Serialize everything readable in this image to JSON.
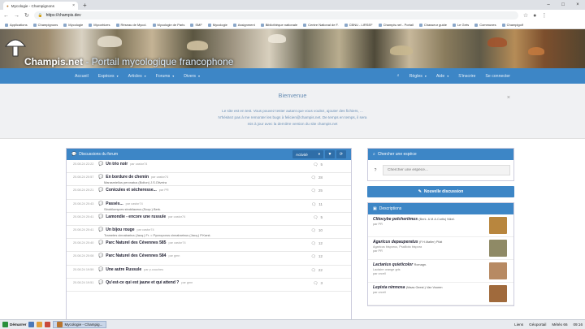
{
  "browser": {
    "tab_title": "Mycologie - Champignons",
    "new_tab": "+",
    "url": "https://champis.dev",
    "bookmarks": [
      "Applications",
      "Champignons",
      "Mycologie",
      "Mycorhizes",
      "Réseau de Mycol.",
      "Mycologie de Paris",
      "SMF",
      "Mycologie",
      "Assignment",
      "Bibliothèque nationale",
      "Centre National de F.",
      "CBNU - LIRSEF",
      "Champis.net - Portail",
      "Chasseur guide",
      "Le Grès",
      "Communes",
      "Champigolf"
    ]
  },
  "site": {
    "name": "Champis.net",
    "tagline": " - Portail mycologique francophone"
  },
  "nav": {
    "left": [
      {
        "label": "Accueil",
        "caret": false
      },
      {
        "label": "Espèces",
        "caret": true
      },
      {
        "label": "Articles",
        "caret": true
      },
      {
        "label": "Forums",
        "caret": true
      },
      {
        "label": "Divers",
        "caret": true
      }
    ],
    "right": [
      {
        "label": "Règles",
        "caret": true
      },
      {
        "label": "Aide",
        "caret": true
      },
      {
        "label": "S'inscrire",
        "caret": false
      },
      {
        "label": "Se connecter",
        "caret": false
      }
    ]
  },
  "welcome": {
    "title": "Bienvenue",
    "lines": [
      "Le site est en test. Vous pouvez tester autant que vous voulez, ajouter des fichiers, ...",
      "N'hésitez pas à me remonter les bugs à felicien@champis.net. De temps en temps, il sera",
      "mis à jour avec la dernière version du site champis.net"
    ],
    "close": "×"
  },
  "forum": {
    "title": "Discussions du forum",
    "filter_label": "Activité",
    "rows": [
      {
        "date": "20.08.24 22:22",
        "title": "Un trio noir",
        "by": "par castor74",
        "sub": "",
        "count": "5"
      },
      {
        "date": "20.08.24 20:57",
        "title": "En bordure de chemin",
        "by": "par castor74",
        "sub": "Marasmiellus peronatus (Bolton) J.S.Oliveira",
        "count": "28"
      },
      {
        "date": "20.08.24 20:21",
        "title": "Conicules et sécheresse...",
        "by": "par PR",
        "sub": "",
        "count": "25"
      },
      {
        "date": "20.08.24 20:43",
        "title": "Passés...",
        "by": "par castor74",
        "sub": "Strobilomyces strobilaceus (Scop.) Berk.",
        "count": "11"
      },
      {
        "date": "20.08.24 20:41",
        "title": "Lamondie - encore une russule",
        "by": "par castor74",
        "sub": "",
        "count": "5"
      },
      {
        "date": "20.08.24 20:41",
        "title": "Un bijou rouge",
        "by": "par castor74",
        "sub": "Trametes cinnabarina (Jacq.) Fr. = Pycnoporus cinnabarinus (Jacq.) P.Karst.",
        "count": "10"
      },
      {
        "date": "20.08.24 20:40",
        "title": "Parc Naturel des Cévennes 585",
        "by": "par castor74",
        "sub": "",
        "count": "12"
      },
      {
        "date": "20.08.24 20:08",
        "title": "Parc Naturel des Cévennes 584",
        "by": "par gmn",
        "sub": "",
        "count": "12"
      },
      {
        "date": "20.08.24 19:59",
        "title": "Une autre Russule",
        "by": "par p.coucheu",
        "sub": "",
        "count": "22"
      },
      {
        "date": "20.08.24 19:51",
        "title": "Qu'est-ce qui est jaune et qui attend ?",
        "by": "par gmn",
        "sub": "",
        "count": "3"
      }
    ]
  },
  "sidebar": {
    "search_title": "Chercher une espèce",
    "search_placeholder": "Chercher une espèce...",
    "new_discussion": "Nouvelle discussion",
    "desc_title": "Descriptions",
    "descriptions": [
      {
        "name": "Clitocybe polcheriimus",
        "author": "(Berk. & M.A.Curtis) Nikel.",
        "syn": "",
        "by": "par PR",
        "color": "#b8863e"
      },
      {
        "name": "Agaricus depauperatus",
        "author": "(F.H.Møller) Pilát",
        "syn": "Agaricus bisporus, Psalliota bispora",
        "by": "par PR",
        "color": "#8f8a66"
      },
      {
        "name": "Lactarius quieticolor",
        "author": "Romagn.",
        "syn": "Lactaire orange gris",
        "by": "par orcell",
        "color": "#b78a63"
      },
      {
        "name": "Lepista nimnosa",
        "author": "(Maas Geest.) Van Vooren",
        "syn": "",
        "by": "par orcell",
        "color": "#a06a3c"
      }
    ]
  },
  "taskbar": {
    "start": "Démarrer",
    "active_task": "Mycologie - Champig...",
    "tray": [
      "Liens",
      "Géoportail",
      "Météo 66",
      "09:16"
    ]
  }
}
